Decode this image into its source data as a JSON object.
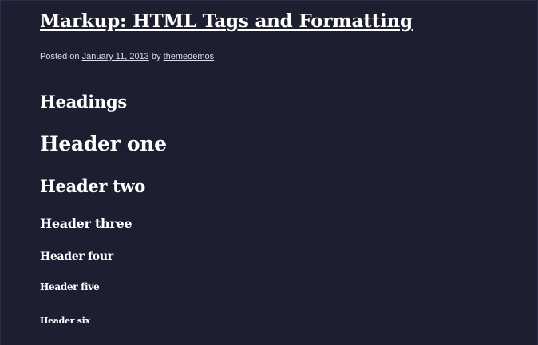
{
  "post": {
    "title": "Markup: HTML Tags and Formatting",
    "meta": {
      "posted_on_label": "Posted on",
      "date": "January 11, 2013",
      "by_label": "by",
      "author": "themedemos"
    }
  },
  "content": {
    "section_heading": "Headings",
    "headers": {
      "h1": "Header one",
      "h2": "Header two",
      "h3": "Header three",
      "h4": "Header four",
      "h5": "Header five",
      "h6": "Header six"
    }
  },
  "colors": {
    "background": "#1d1f31",
    "text": "#ffffff",
    "meta_text": "#dcdce4"
  }
}
